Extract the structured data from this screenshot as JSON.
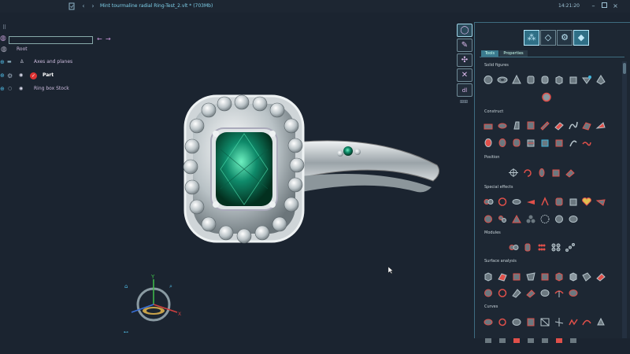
{
  "titlebar": {
    "title": "Mint tourmaline radial Ring-Test_2.vlt * (703Mb)",
    "time": "14:21:20",
    "icons": [
      "document-icon",
      "back-icon",
      "forward-icon",
      "minimize-icon",
      "maximize-icon",
      "close-icon"
    ]
  },
  "left_panel": {
    "search_value": "",
    "tree": [
      {
        "label": "Root",
        "icon": "globe-icon"
      },
      {
        "label": "Axes and planes",
        "icon": "folder-icon"
      },
      {
        "label": "Part",
        "icon": "part-icon",
        "bold": true
      },
      {
        "label": "Ring box Stock",
        "icon": "ring-icon"
      }
    ]
  },
  "right_panel": {
    "tabs": [
      "ring-icon",
      "pen-icon",
      "network-icon",
      "tools-icon",
      "cad-icon"
    ],
    "header_buttons": [
      "stones-icon",
      "gem-icon",
      "settings-gem-icon",
      "diamond-icon"
    ],
    "subtabs": [
      "Tools",
      "Properties"
    ],
    "sections": [
      {
        "label": "Solid figures"
      },
      {
        "label": "Construct"
      },
      {
        "label": "Position"
      },
      {
        "label": "Special effects"
      },
      {
        "label": "Modules"
      },
      {
        "label": "Surface analysis"
      },
      {
        "label": "Curves"
      }
    ]
  },
  "colors": {
    "background": "#1b2430",
    "panel": "#1d2733",
    "accent": "#3fb6dc",
    "tool_red": "#e0504a",
    "gem_green": "#0f8a6a"
  },
  "gizmo": {
    "axes": [
      "Y",
      "X",
      "Z"
    ]
  }
}
